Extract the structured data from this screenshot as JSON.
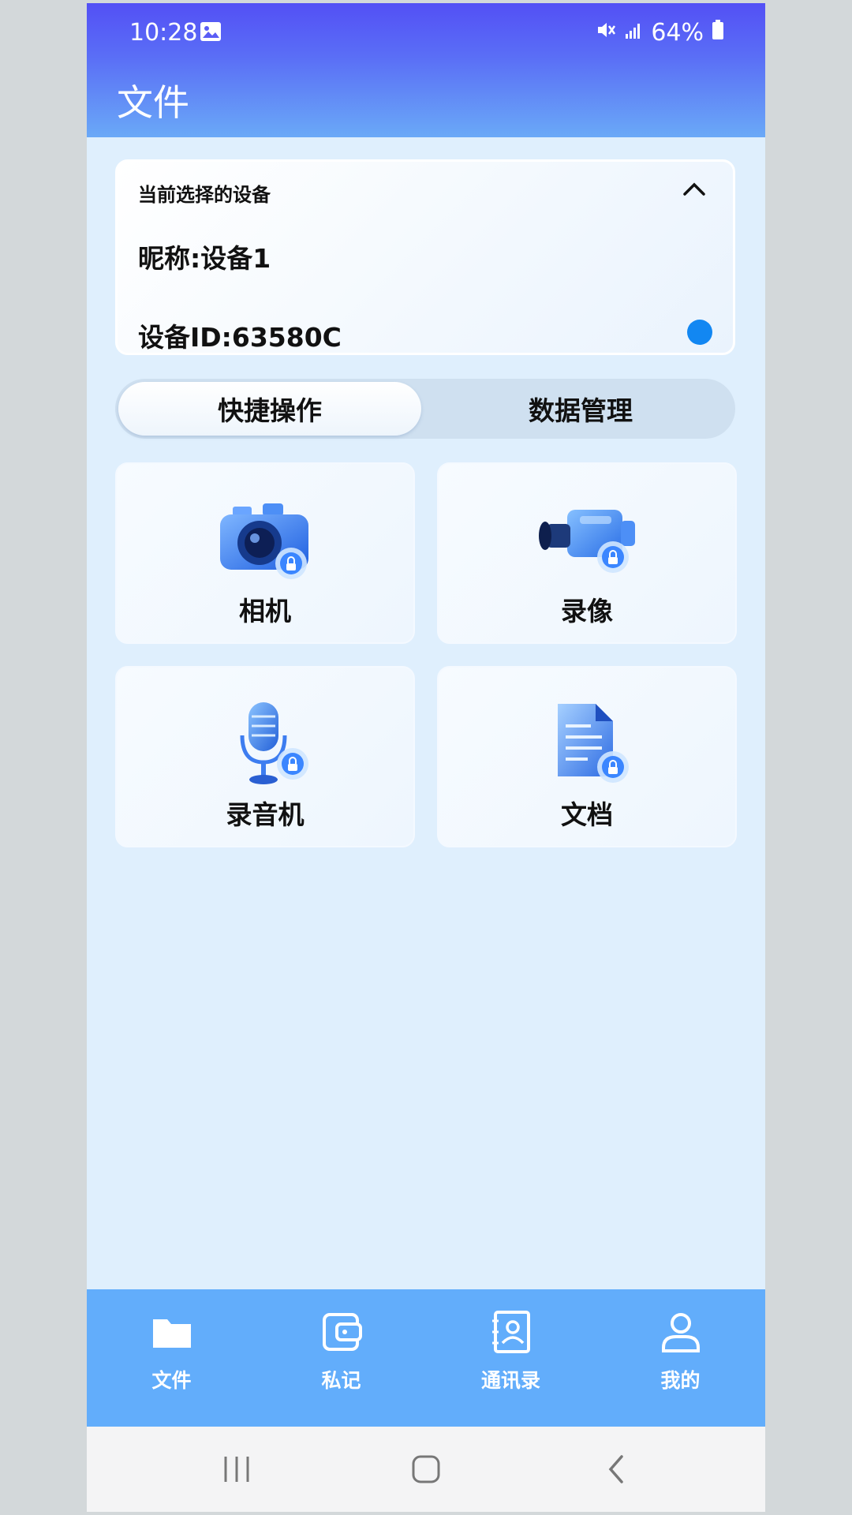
{
  "status_bar": {
    "time": "10:28",
    "battery": "64%"
  },
  "header": {
    "title": "文件"
  },
  "device_card": {
    "heading": "当前选择的设备",
    "nickname": "昵称:设备1",
    "device_id": "设备ID:63580C",
    "status_color": "#1287f2"
  },
  "tabs": [
    {
      "label": "快捷操作",
      "active": true
    },
    {
      "label": "数据管理",
      "active": false
    }
  ],
  "features": [
    {
      "label": "相机",
      "icon": "camera-lock-icon"
    },
    {
      "label": "录像",
      "icon": "video-camera-lock-icon"
    },
    {
      "label": "录音机",
      "icon": "microphone-lock-icon"
    },
    {
      "label": "文档",
      "icon": "document-lock-icon"
    }
  ],
  "bottom_nav": [
    {
      "label": "文件",
      "icon": "folder-icon"
    },
    {
      "label": "私记",
      "icon": "wallet-icon"
    },
    {
      "label": "通讯录",
      "icon": "contacts-book-icon"
    },
    {
      "label": "我的",
      "icon": "person-icon"
    }
  ],
  "colors": {
    "accent": "#5350f5",
    "nav_bg": "#62adfb",
    "page_bg": "#dfeffd"
  }
}
